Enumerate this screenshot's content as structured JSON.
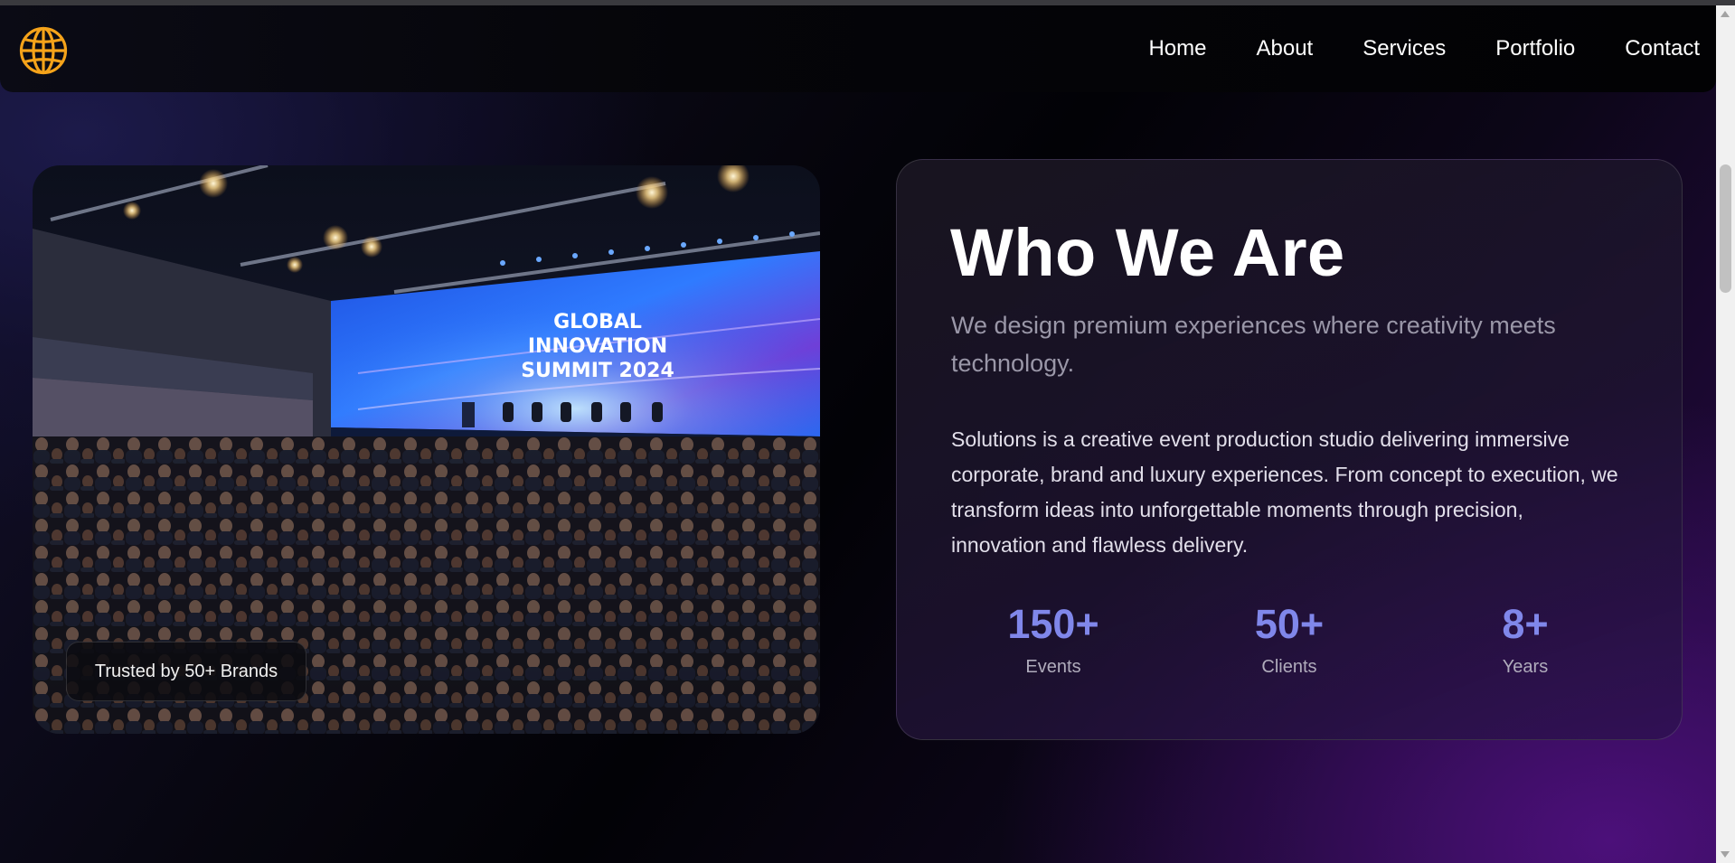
{
  "logo": {
    "icon": "globe-icon",
    "color": "#f5a31a"
  },
  "nav": {
    "items": [
      {
        "label": "Home"
      },
      {
        "label": "About"
      },
      {
        "label": "Services"
      },
      {
        "label": "Portfolio"
      },
      {
        "label": "Contact"
      }
    ]
  },
  "hero_image": {
    "screen_text": [
      "GLOBAL",
      "INNOVATION",
      "SUMMIT 2024"
    ],
    "badge": "Trusted by 50+ Brands"
  },
  "about": {
    "title": "Who We Are",
    "subtitle": "We design premium experiences where creativity meets technology.",
    "description": "Solutions is a creative event production studio delivering immersive corporate, brand and luxury experiences. From concept to execution, we transform ideas into unforgettable moments through precision, innovation and flawless delivery.",
    "stats": [
      {
        "value": "150+",
        "label": "Events"
      },
      {
        "value": "50+",
        "label": "Clients"
      },
      {
        "value": "8+",
        "label": "Years"
      }
    ]
  },
  "colors": {
    "accent": "#8087ea",
    "logo": "#f5a31a",
    "background_glow": "#4e107d"
  }
}
